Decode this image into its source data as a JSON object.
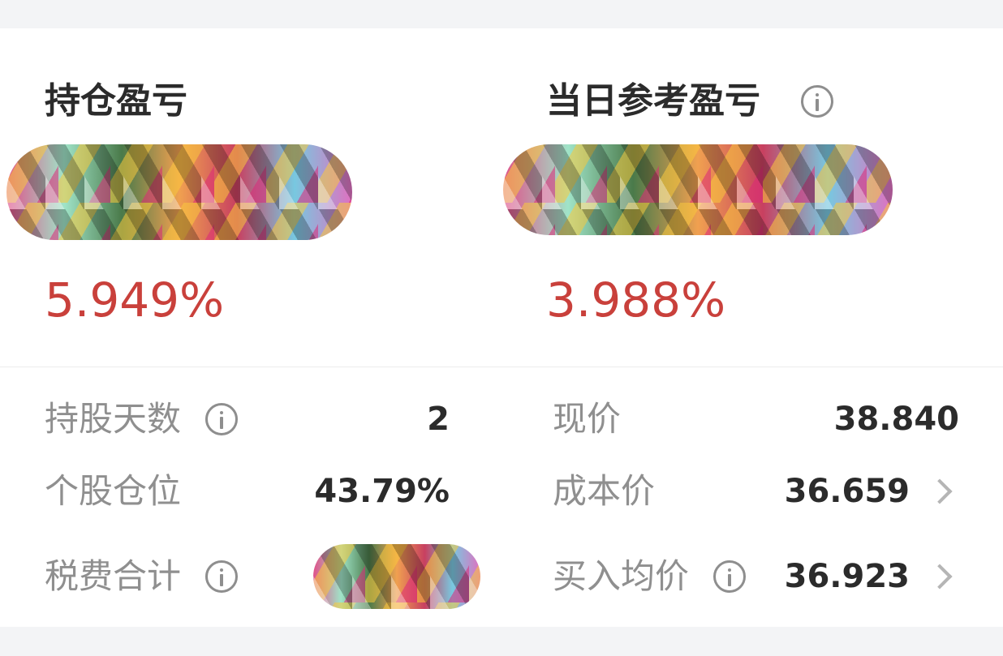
{
  "left": {
    "title": "持仓盈亏",
    "percent": "5.949%"
  },
  "right": {
    "title": "当日参考盈亏",
    "percent": "3.988%"
  },
  "details": {
    "holding_days": {
      "label": "持股天数",
      "value": "2"
    },
    "position_ratio": {
      "label": "个股仓位",
      "value": "43.79%"
    },
    "fees_total": {
      "label": "税费合计"
    },
    "current_price": {
      "label": "现价",
      "value": "38.840"
    },
    "cost_price": {
      "label": "成本价",
      "value": "36.659"
    },
    "avg_buy_price": {
      "label": "买入均价",
      "value": "36.923"
    }
  },
  "icons": [
    "info-icon",
    "chevron-right-icon"
  ],
  "colors": {
    "profit_red": "#c9403b",
    "label_gray": "#8f8f8f",
    "value_dark": "#2b2b2b"
  }
}
